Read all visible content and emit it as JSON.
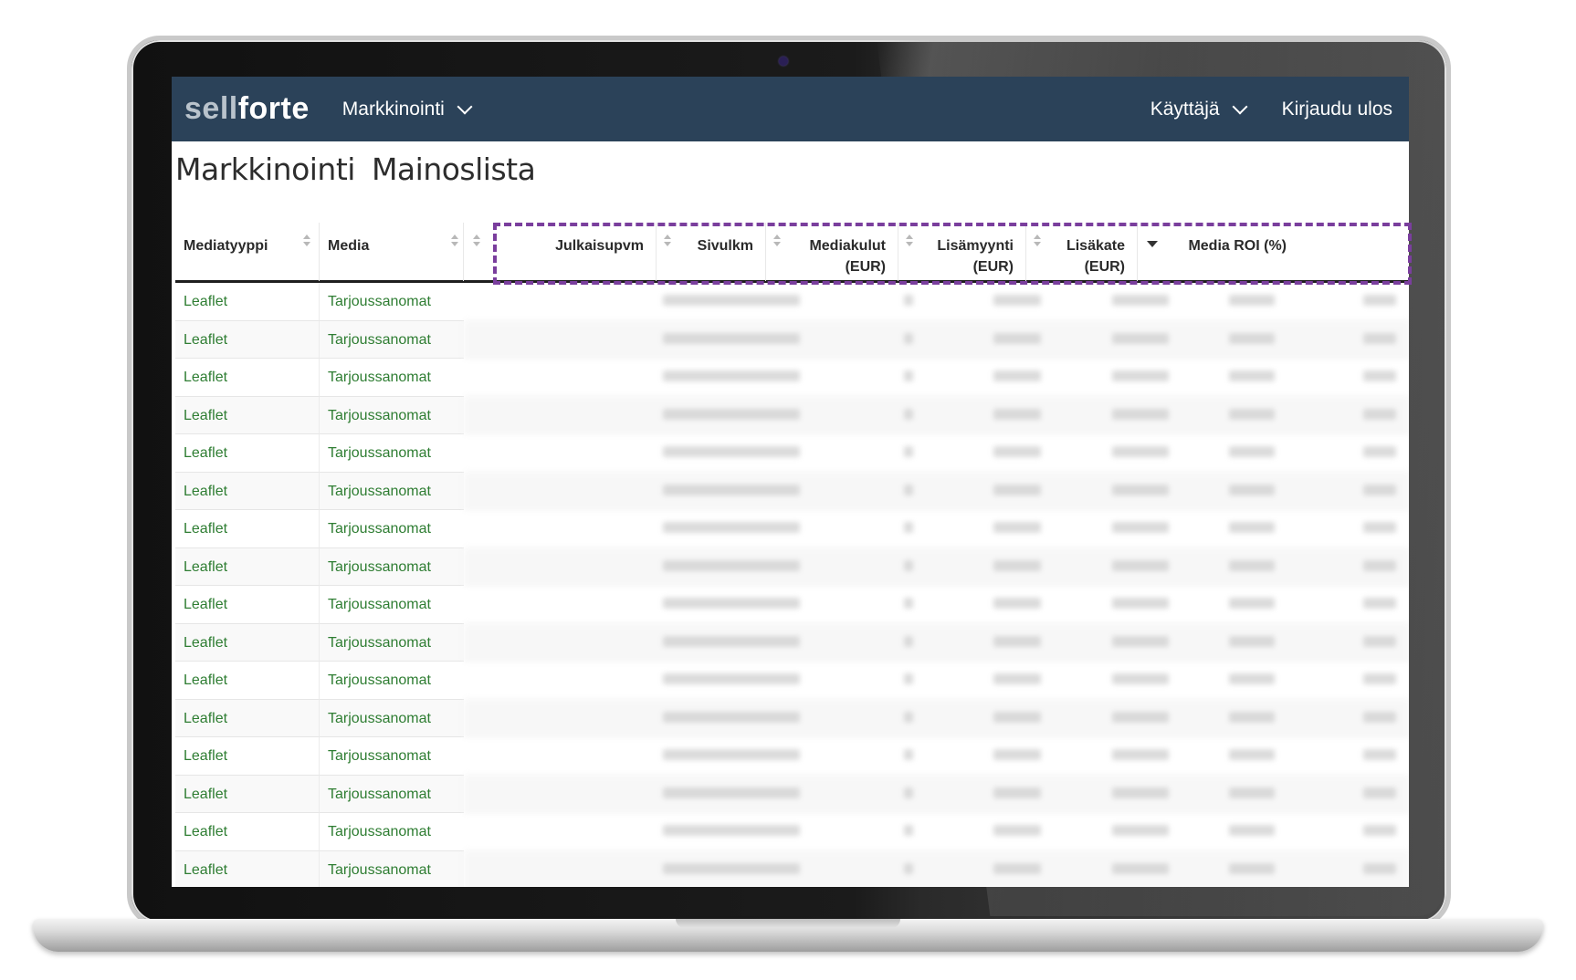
{
  "header": {
    "logo_sell": "sell",
    "logo_forte": "forte",
    "nav_marketing": "Markkinointi",
    "nav_user": "Käyttäjä",
    "nav_logout": "Kirjaudu ulos"
  },
  "page": {
    "title_part1": "Markkinointi",
    "title_part2": "Mainoslista"
  },
  "table": {
    "columns": [
      {
        "label": "Mediatyyppi"
      },
      {
        "label": "Media"
      },
      {
        "label": "Julkaisupvm"
      },
      {
        "label": "Sivulkm"
      },
      {
        "label": "Mediakulut",
        "label2": "(EUR)"
      },
      {
        "label": "Lisämyynti",
        "label2": "(EUR)"
      },
      {
        "label": "Lisäkate",
        "label2": "(EUR)"
      },
      {
        "label": "Media ROI (%)"
      }
    ],
    "rows": [
      {
        "type": "Leaflet",
        "media": "Tarjoussanomat"
      },
      {
        "type": "Leaflet",
        "media": "Tarjoussanomat"
      },
      {
        "type": "Leaflet",
        "media": "Tarjoussanomat"
      },
      {
        "type": "Leaflet",
        "media": "Tarjoussanomat"
      },
      {
        "type": "Leaflet",
        "media": "Tarjoussanomat"
      },
      {
        "type": "Leaflet",
        "media": "Tarjoussanomat"
      },
      {
        "type": "Leaflet",
        "media": "Tarjoussanomat"
      },
      {
        "type": "Leaflet",
        "media": "Tarjoussanomat"
      },
      {
        "type": "Leaflet",
        "media": "Tarjoussanomat"
      },
      {
        "type": "Leaflet",
        "media": "Tarjoussanomat"
      },
      {
        "type": "Leaflet",
        "media": "Tarjoussanomat"
      },
      {
        "type": "Leaflet",
        "media": "Tarjoussanomat"
      },
      {
        "type": "Leaflet",
        "media": "Tarjoussanomat"
      },
      {
        "type": "Leaflet",
        "media": "Tarjoussanomat"
      },
      {
        "type": "Leaflet",
        "media": "Tarjoussanomat"
      },
      {
        "type": "Leaflet",
        "media": "Tarjoussanomat"
      }
    ]
  },
  "colors": {
    "topbar": "#2b4259",
    "link_green": "#2e7d32",
    "highlight": "#7a3e9d"
  }
}
